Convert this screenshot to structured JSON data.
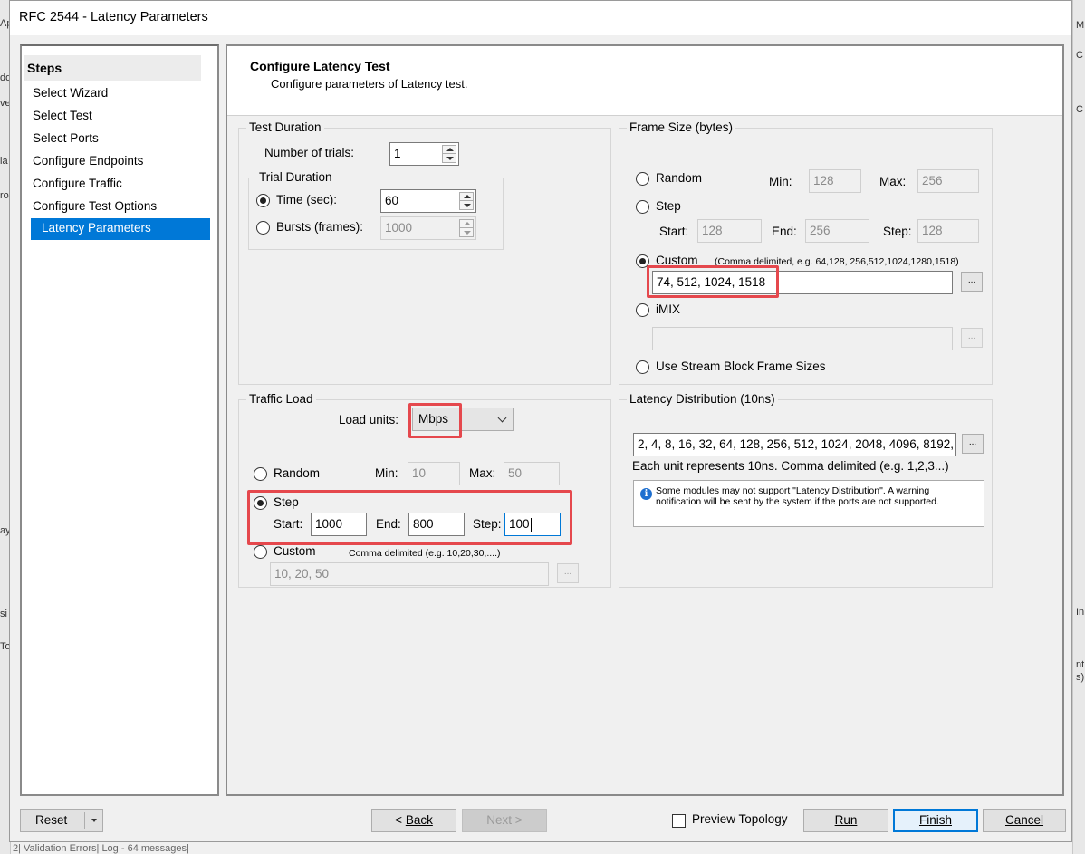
{
  "window": {
    "title": "RFC 2544 - Latency Parameters"
  },
  "background": {
    "left_fragments": [
      "Ap",
      "dd",
      "ve",
      "la",
      "ro",
      "ay",
      "si",
      "To"
    ],
    "right_fragments": [
      "M",
      "C",
      "C",
      "In",
      "nt",
      "s)"
    ],
    "status_bar": "2| Validation Errors| Log - 64 messages|"
  },
  "steps": {
    "heading": "Steps",
    "items": [
      {
        "label": "Select Wizard"
      },
      {
        "label": "Select Test"
      },
      {
        "label": "Select Ports"
      },
      {
        "label": "Configure Endpoints"
      },
      {
        "label": "Configure Traffic"
      },
      {
        "label": "Configure Test Options"
      },
      {
        "label": "Latency Parameters"
      }
    ],
    "active_index": 6
  },
  "header": {
    "title": "Configure Latency Test",
    "subtitle": "Configure parameters of Latency test."
  },
  "test_duration": {
    "label": "Test Duration",
    "trials_label": "Number of trials:",
    "trials_value": "1",
    "trial_duration_label": "Trial Duration",
    "time_label": "Time (sec):",
    "time_value": "60",
    "bursts_label": "Bursts (frames):",
    "bursts_value": "1000",
    "selected": "time"
  },
  "frame_size": {
    "label": "Frame Size (bytes)",
    "random_label": "Random",
    "min_label": "Min:",
    "min_value": "128",
    "max_label": "Max:",
    "max_value": "256",
    "step_label": "Step",
    "start_label": "Start:",
    "start_value": "128",
    "end_label": "End:",
    "end_value": "256",
    "step_size_label": "Step:",
    "step_size_value": "128",
    "custom_label": "Custom",
    "custom_hint": "(Comma delimited, e.g. 64,128, 256,512,1024,1280,1518)",
    "custom_value": "74, 512, 1024, 1518",
    "imix_label": "iMIX",
    "imix_value": "",
    "stream_block_label": "Use Stream Block Frame Sizes",
    "browse": "...",
    "selected": "custom"
  },
  "traffic_load": {
    "label": "Traffic Load",
    "load_units_label": "Load units:",
    "load_units_value": "Mbps",
    "random_label": "Random",
    "min_label": "Min:",
    "min_value": "10",
    "max_label": "Max:",
    "max_value": "50",
    "step_label": "Step",
    "start_label": "Start:",
    "start_value": "1000",
    "end_label": "End:",
    "end_value": "800",
    "step_size_label": "Step:",
    "step_size_value": "100",
    "custom_label": "Custom",
    "custom_hint": "Comma delimited (e.g. 10,20,30,....)",
    "custom_value": "10, 20, 50",
    "browse": "...",
    "selected": "step"
  },
  "latency_distribution": {
    "label": "Latency Distribution (10ns)",
    "value": "2, 4, 8, 16, 32, 64, 128, 256, 512, 1024, 2048, 4096, 8192,",
    "browse": "...",
    "hint": "Each unit represents 10ns. Comma delimited (e.g.  1,2,3...)",
    "info_icon": "i",
    "info_text": "Some modules may not support \"Latency Distribution\". A warning notification will be sent by the system if the ports are not supported."
  },
  "footer": {
    "reset": "Reset",
    "back_arrow": "< ",
    "back": "Back",
    "next": "Next >",
    "preview_topology": "Preview Topology",
    "run": "Run",
    "finish": "Finish",
    "cancel": "Cancel"
  },
  "highlight_color": "#e5484d",
  "accent_color": "#0078d7"
}
